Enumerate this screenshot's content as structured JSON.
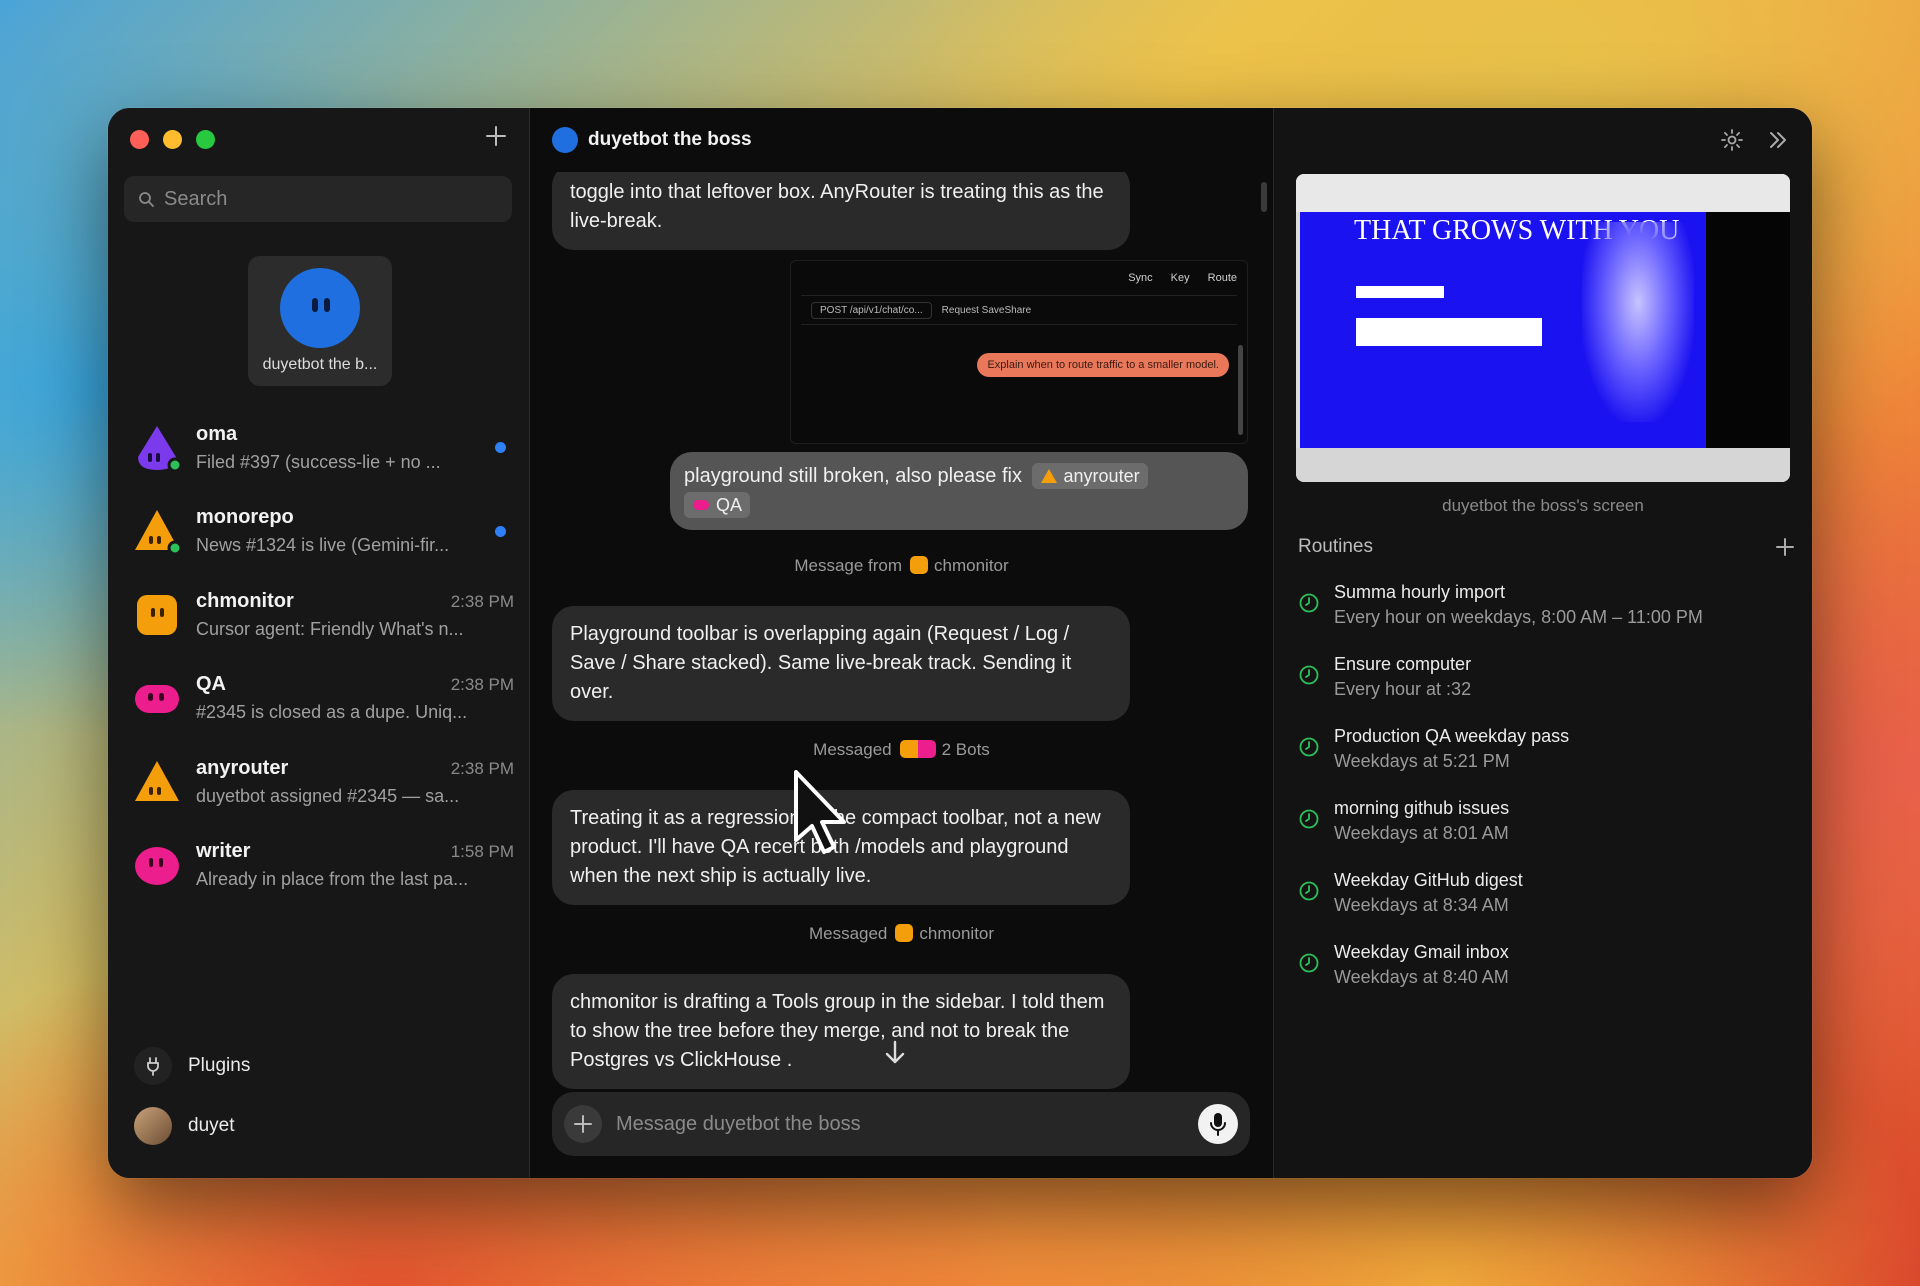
{
  "sidebar": {
    "search_placeholder": "Search",
    "pinned": {
      "name": "duyetbot the b..."
    },
    "chats": [
      {
        "title": "oma",
        "time": "",
        "preview": "Filed #397 (success-lie + no ...",
        "unread": true,
        "color": "#7c3aed"
      },
      {
        "title": "monorepo",
        "time": "",
        "preview": "News #1324 is live (Gemini-fir...",
        "unread": true,
        "color": "#f59e0b"
      },
      {
        "title": "chmonitor",
        "time": "2:38 PM",
        "preview": "Cursor agent: Friendly What's n...",
        "unread": false,
        "color": "#f59e0b"
      },
      {
        "title": "QA",
        "time": "2:38 PM",
        "preview": "#2345 is closed as a dupe. Uniq...",
        "unread": false,
        "color": "#ec1d8c"
      },
      {
        "title": "anyrouter",
        "time": "2:38 PM",
        "preview": "duyetbot assigned #2345 — sa...",
        "unread": false,
        "color": "#f59e0b"
      },
      {
        "title": "writer",
        "time": "1:58 PM",
        "preview": "Already in place from the last pa...",
        "unread": false,
        "color": "#ec1d8c"
      }
    ],
    "plugins_label": "Plugins",
    "user_name": "duyet"
  },
  "chat": {
    "title": "duyetbot the boss",
    "messages": {
      "m1": "toggle into that leftover box. AnyRouter is treating this as the live-break.",
      "user_msg_text": "playground still broken, also please fix",
      "user_chip1": "anyrouter",
      "user_chip2": "QA",
      "meta1_prefix": "Message from",
      "meta1_name": "chmonitor",
      "m2": "Playground toolbar is overlapping again (Request / Log / Save / Share stacked). Same live-break track. Sending it over.",
      "meta2_prefix": "Messaged",
      "meta2_name": "2 Bots",
      "m3": "Treating it as a regression of the compact toolbar, not a new product. I'll have QA recert both /models and playground when the next ship is actually live.",
      "meta3_prefix": "Messaged",
      "meta3_name": "chmonitor",
      "m4": "chmonitor is drafting a Tools group in the sidebar. I told them to show the tree before they merge, and not to break the Postgres vs ClickHouse ."
    },
    "screenshot": {
      "sync": "Sync",
      "key": "Key",
      "route": "Route",
      "path": "POST /api/v1/chat/co...",
      "toolbar_text": "Request SaveShare",
      "pill": "Explain when to route traffic to a smaller model."
    },
    "composer_placeholder": "Message duyetbot the boss"
  },
  "panel": {
    "screen_caption": "duyetbot the boss's screen",
    "screen_headline": "THAT GROWS WITH YOU",
    "routines_title": "Routines",
    "routines": [
      {
        "name": "Summa hourly import",
        "schedule": "Every hour on weekdays, 8:00 AM – 11:00 PM"
      },
      {
        "name": "Ensure computer",
        "schedule": "Every hour at :32"
      },
      {
        "name": "Production QA weekday pass",
        "schedule": "Weekdays at 5:21 PM"
      },
      {
        "name": "morning github issues",
        "schedule": "Weekdays at 8:01 AM"
      },
      {
        "name": "Weekday GitHub digest",
        "schedule": "Weekdays at 8:34 AM"
      },
      {
        "name": "Weekday Gmail inbox",
        "schedule": "Weekdays at 8:40 AM"
      }
    ]
  }
}
